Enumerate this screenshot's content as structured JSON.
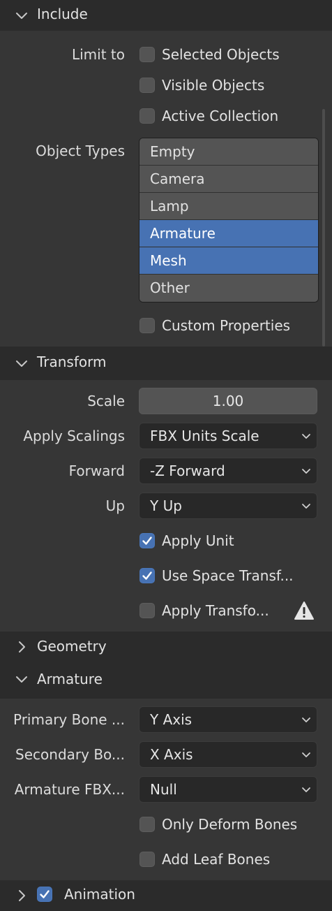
{
  "include": {
    "header": "Include",
    "limit_to_label": "Limit to",
    "limit_options": [
      {
        "label": "Selected Objects",
        "checked": false
      },
      {
        "label": "Visible Objects",
        "checked": false
      },
      {
        "label": "Active Collection",
        "checked": false
      }
    ],
    "object_types_label": "Object Types",
    "object_types": [
      {
        "label": "Empty",
        "selected": false
      },
      {
        "label": "Camera",
        "selected": false
      },
      {
        "label": "Lamp",
        "selected": false
      },
      {
        "label": "Armature",
        "selected": true
      },
      {
        "label": "Mesh",
        "selected": true
      },
      {
        "label": "Other",
        "selected": false
      }
    ],
    "custom_properties": {
      "label": "Custom Properties",
      "checked": false
    }
  },
  "transform": {
    "header": "Transform",
    "scale_label": "Scale",
    "scale_value": "1.00",
    "apply_scalings_label": "Apply Scalings",
    "apply_scalings_value": "FBX Units Scale",
    "forward_label": "Forward",
    "forward_value": "-Z Forward",
    "up_label": "Up",
    "up_value": "Y Up",
    "apply_unit": {
      "label": "Apply Unit",
      "checked": true
    },
    "use_space_transform": {
      "label": "Use Space Transf...",
      "checked": true
    },
    "apply_transform": {
      "label": "Apply Transfo...",
      "checked": false
    }
  },
  "geometry": {
    "header": "Geometry"
  },
  "armature": {
    "header": "Armature",
    "primary_bone_label": "Primary Bone ...",
    "primary_bone_value": "Y Axis",
    "secondary_bone_label": "Secondary Bo...",
    "secondary_bone_value": "X Axis",
    "armature_node_label": "Armature FBX...",
    "armature_node_value": "Null",
    "only_deform_bones": {
      "label": "Only Deform Bones",
      "checked": false
    },
    "add_leaf_bones": {
      "label": "Add Leaf Bones",
      "checked": false
    }
  },
  "animation": {
    "header": "Animation",
    "checked": true
  },
  "colors": {
    "accent": "#4772b3",
    "panel_bg": "#363636",
    "header_bg": "#2b2b2b",
    "warning": "#e6e6e6"
  }
}
